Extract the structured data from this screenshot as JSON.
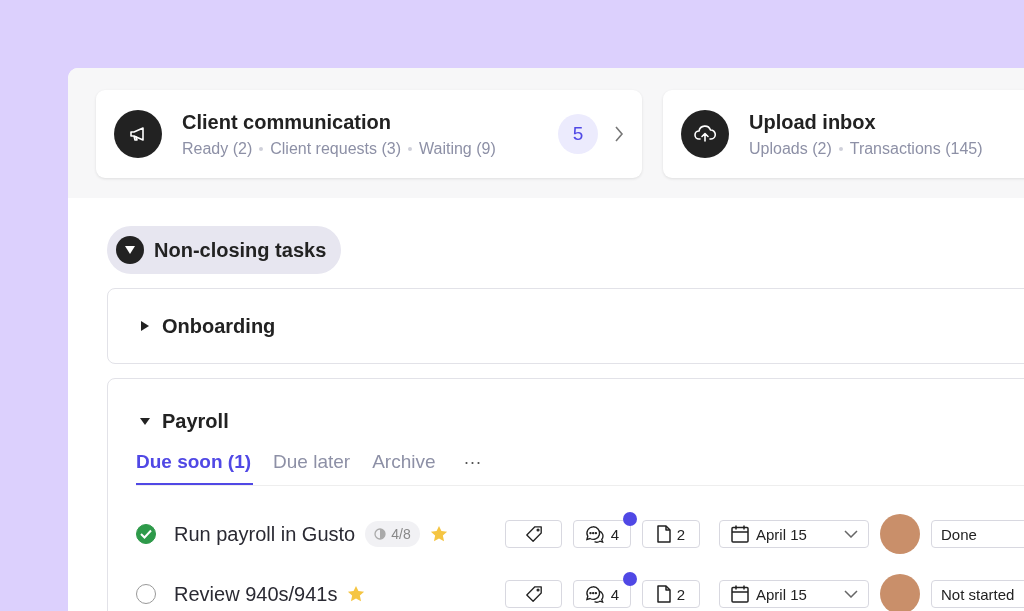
{
  "summary_cards": [
    {
      "kind": "megaphone",
      "title": "Client communication",
      "stats": [
        "Ready (2)",
        "Client requests (3)",
        "Waiting (9)"
      ],
      "count": "5"
    },
    {
      "kind": "upload",
      "title": "Upload inbox",
      "stats": [
        "Uploads (2)",
        "Transactions (145)"
      ]
    }
  ],
  "section": {
    "title": "Non-closing tasks",
    "expanded": true
  },
  "groups": [
    {
      "title": "Onboarding",
      "expanded": false
    },
    {
      "title": "Payroll",
      "expanded": true,
      "tabs": [
        {
          "label": "Due soon (1)",
          "selected": true
        },
        {
          "label": "Due later",
          "selected": false
        },
        {
          "label": "Archive",
          "selected": false
        }
      ],
      "more": "···",
      "tasks": [
        {
          "title": "Run payroll in Gusto",
          "done": true,
          "progress": "4/8",
          "starred": true,
          "comments": "4",
          "unread": true,
          "files": "2",
          "due": "April 15",
          "status": "Done"
        },
        {
          "title": "Review 940s/941s",
          "done": false,
          "starred": true,
          "comments": "4",
          "unread": true,
          "files": "2",
          "due": "April 15",
          "status": "Not started"
        }
      ]
    }
  ]
}
